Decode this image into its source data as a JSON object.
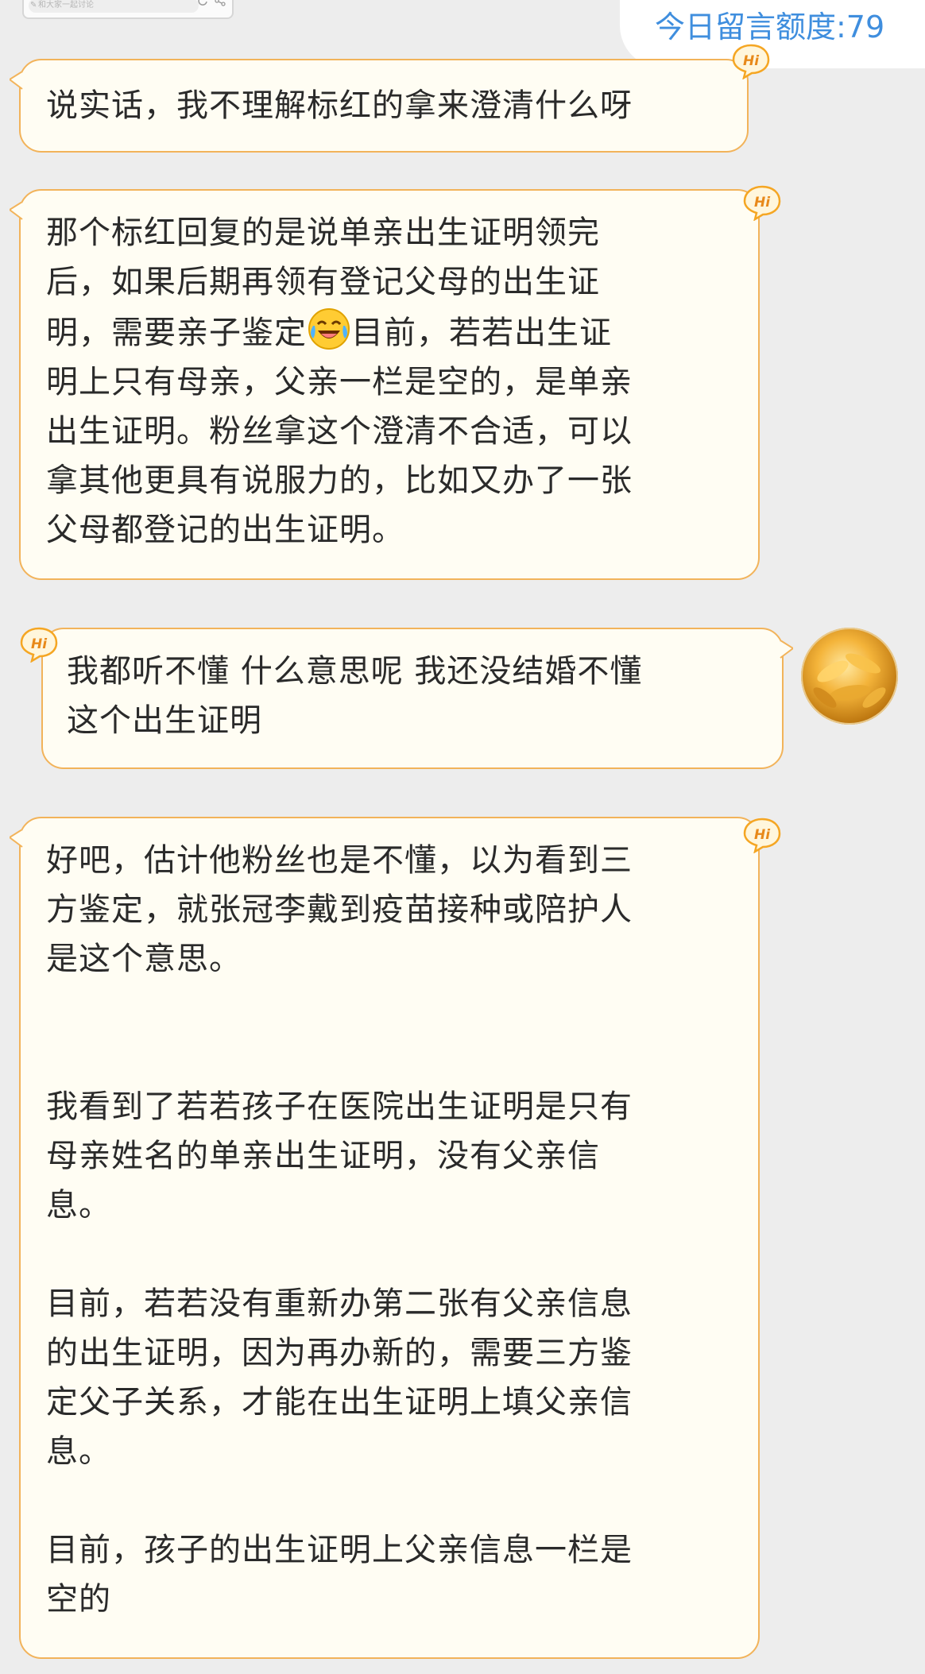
{
  "header": {
    "search_placeholder": "和大家一起讨论",
    "quota_label": "今日留言额度:79"
  },
  "badges": {
    "hi": "Hi"
  },
  "messages": [
    {
      "side": "left",
      "text": "说实话，我不理解标红的拿来澄清什么呀"
    },
    {
      "side": "left",
      "text_before": "那个标红回复的是说单亲出生证明领完\n后，如果后期再领有登记父母的出生证\n明，需要亲子鉴定",
      "emoji": "laughing-crying-emoji",
      "text_after": "目前，若若出生证\n明上只有母亲，父亲一栏是空的，是单亲\n出生证明。粉丝拿这个澄清不合适，可以\n拿其他更具有说服力的，比如又办了一张\n父母都登记的出生证明。"
    },
    {
      "side": "right",
      "text": "我都听不懂 什么意思呢 我还没结婚不懂\n这个出生证明"
    },
    {
      "side": "left",
      "text": "好吧，估计他粉丝也是不懂，以为看到三\n方鉴定，就张冠李戴到疫苗接种或陪护人\n是这个意思。\n\n\n我看到了若若孩子在医院出生证明是只有\n母亲姓名的单亲出生证明，没有父亲信\n息。\n\n目前，若若没有重新办第二张有父亲信息\n的出生证明，因为再办新的，需要三方鉴\n定父子关系，才能在出生证明上填父亲信\n息。\n\n目前，孩子的出生证明上父亲信息一栏是\n空的"
    }
  ],
  "colors": {
    "background": "#ededed",
    "bubble_fill": "#fffdf3",
    "bubble_border": "#f2b35a",
    "quota_text": "#3f8ede",
    "hi_badge": "#f5a623"
  }
}
